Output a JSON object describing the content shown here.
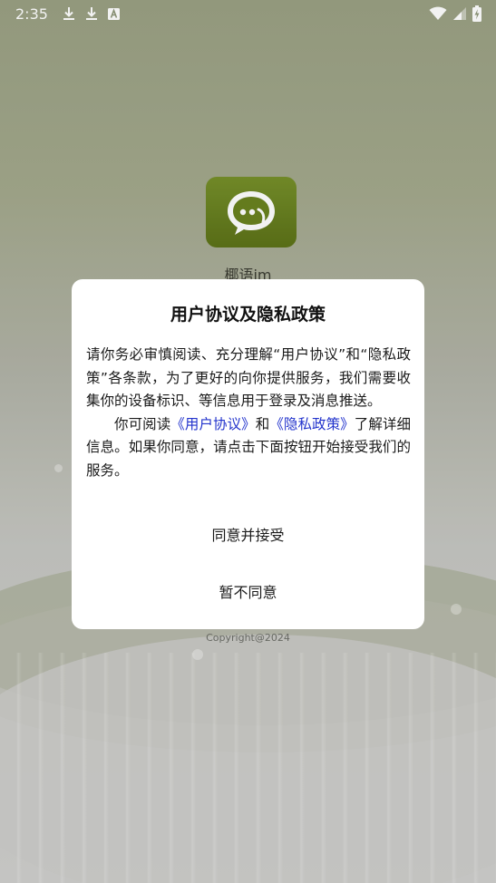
{
  "status_bar": {
    "time": "2:35",
    "icons": [
      "download-icon",
      "download-icon",
      "a-box-icon",
      "wifi-icon",
      "signal-icon",
      "battery-charging-icon"
    ]
  },
  "app": {
    "name": "椰语im",
    "copyright": "Copyright@2024",
    "logo_icon": "chat-bubble-icon",
    "logo_color": "#6a821f"
  },
  "dialog": {
    "title": "用户协议及隐私政策",
    "paragraph1": "请你务必审慎阅读、充分理解“用户协议”和“隐私政策”各条款，为了更好的向你提供服务，我们需要收集你的设备标识、等信息用于登录及消息推送。",
    "paragraph2_prefix": "你可阅读",
    "user_agreement_link": "《用户协议》",
    "paragraph2_and": "和",
    "privacy_policy_link": "《隐私政策》",
    "paragraph2_suffix": "了解详细信息。如果你同意，请点击下面按钮开始接受我们的服务。",
    "agree_button": "同意并接受",
    "disagree_button": "暂不同意",
    "link_color": "#2233cc"
  }
}
